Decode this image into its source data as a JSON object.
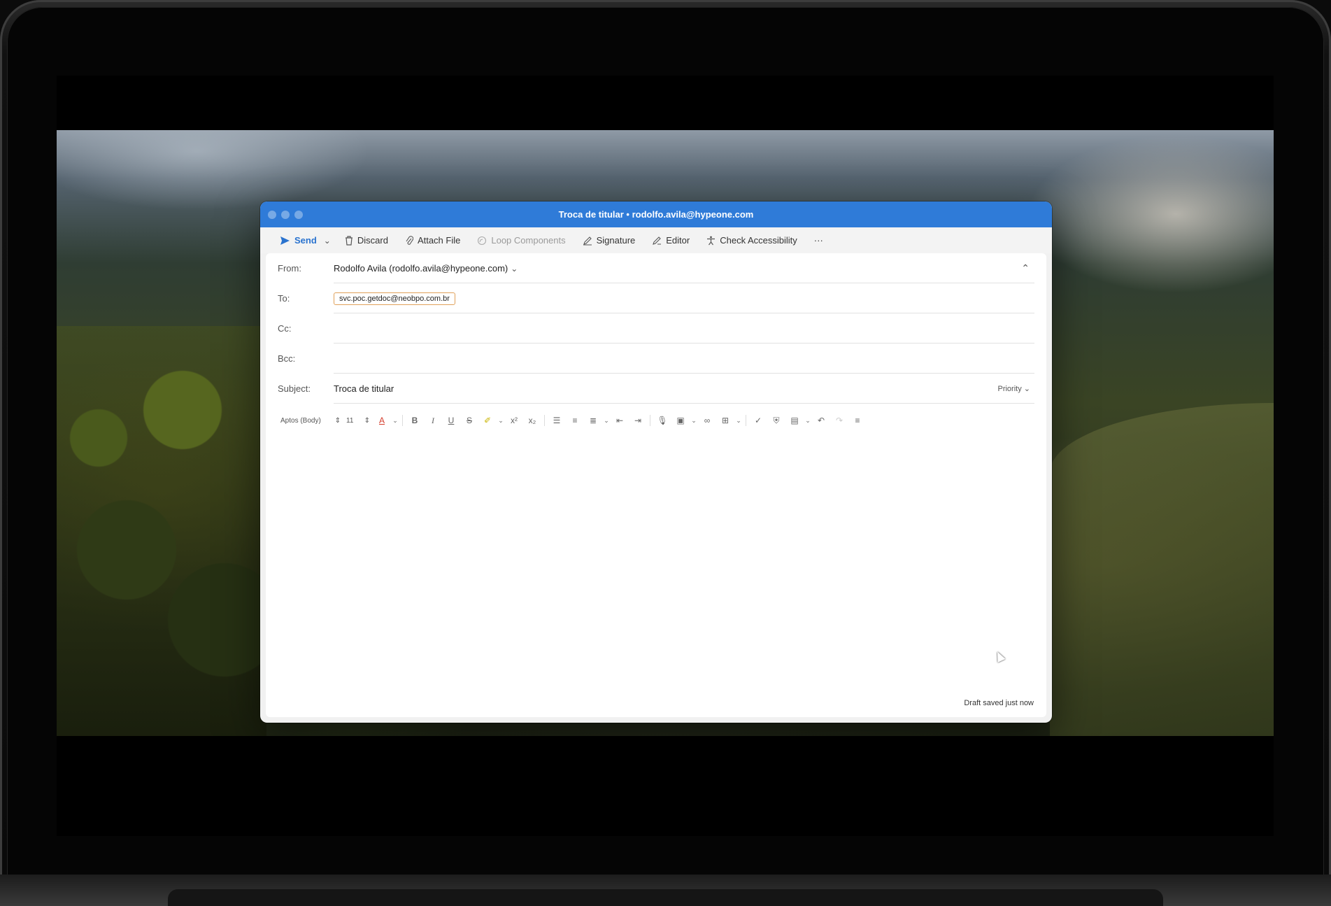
{
  "window": {
    "title": "Troca de titular • rodolfo.avila@hypeone.com"
  },
  "toolbar": {
    "send_label": "Send",
    "discard_label": "Discard",
    "attach_label": "Attach File",
    "loop_label": "Loop Components",
    "signature_label": "Signature",
    "editor_label": "Editor",
    "accessibility_label": "Check Accessibility",
    "more_label": "···"
  },
  "fields": {
    "from_label": "From:",
    "from_value": "Rodolfo Avila (rodolfo.avila@hypeone.com)",
    "to_label": "To:",
    "to_recipient": "svc.poc.getdoc@neobpo.com.br",
    "cc_label": "Cc:",
    "bcc_label": "Bcc:",
    "subject_label": "Subject:",
    "subject_value": "Troca de titular",
    "priority_label": "Priority"
  },
  "format": {
    "font": "Aptos (Body)",
    "size": "11"
  },
  "status": {
    "draft": "Draft saved just now"
  },
  "colors": {
    "titlebar": "#2f7bd8",
    "send": "#2a73cf",
    "chip_border": "#e0a15a"
  }
}
